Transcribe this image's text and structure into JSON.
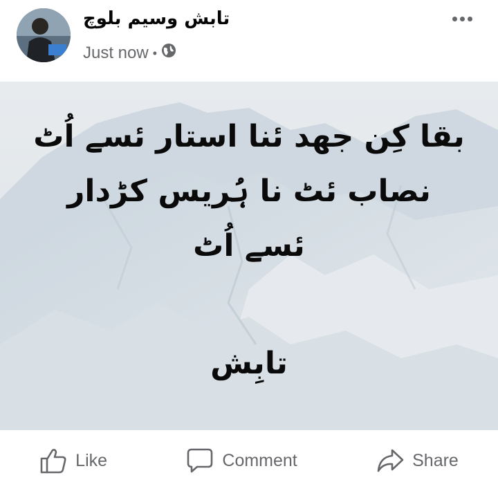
{
  "post": {
    "author": "تابش وسیم بلوچ",
    "timestamp": "Just now",
    "audience_icon": "globe-icon",
    "lines": [
      "بقا کِن جهد ئنا استار ئسے اُٹ",
      "نصاب ئٹ نا ہُریس کڑدار",
      "ئسے اُٹ"
    ],
    "signature": "تابِش",
    "background": "snowy-mountain"
  },
  "actions": {
    "like": "Like",
    "comment": "Comment",
    "share": "Share"
  }
}
